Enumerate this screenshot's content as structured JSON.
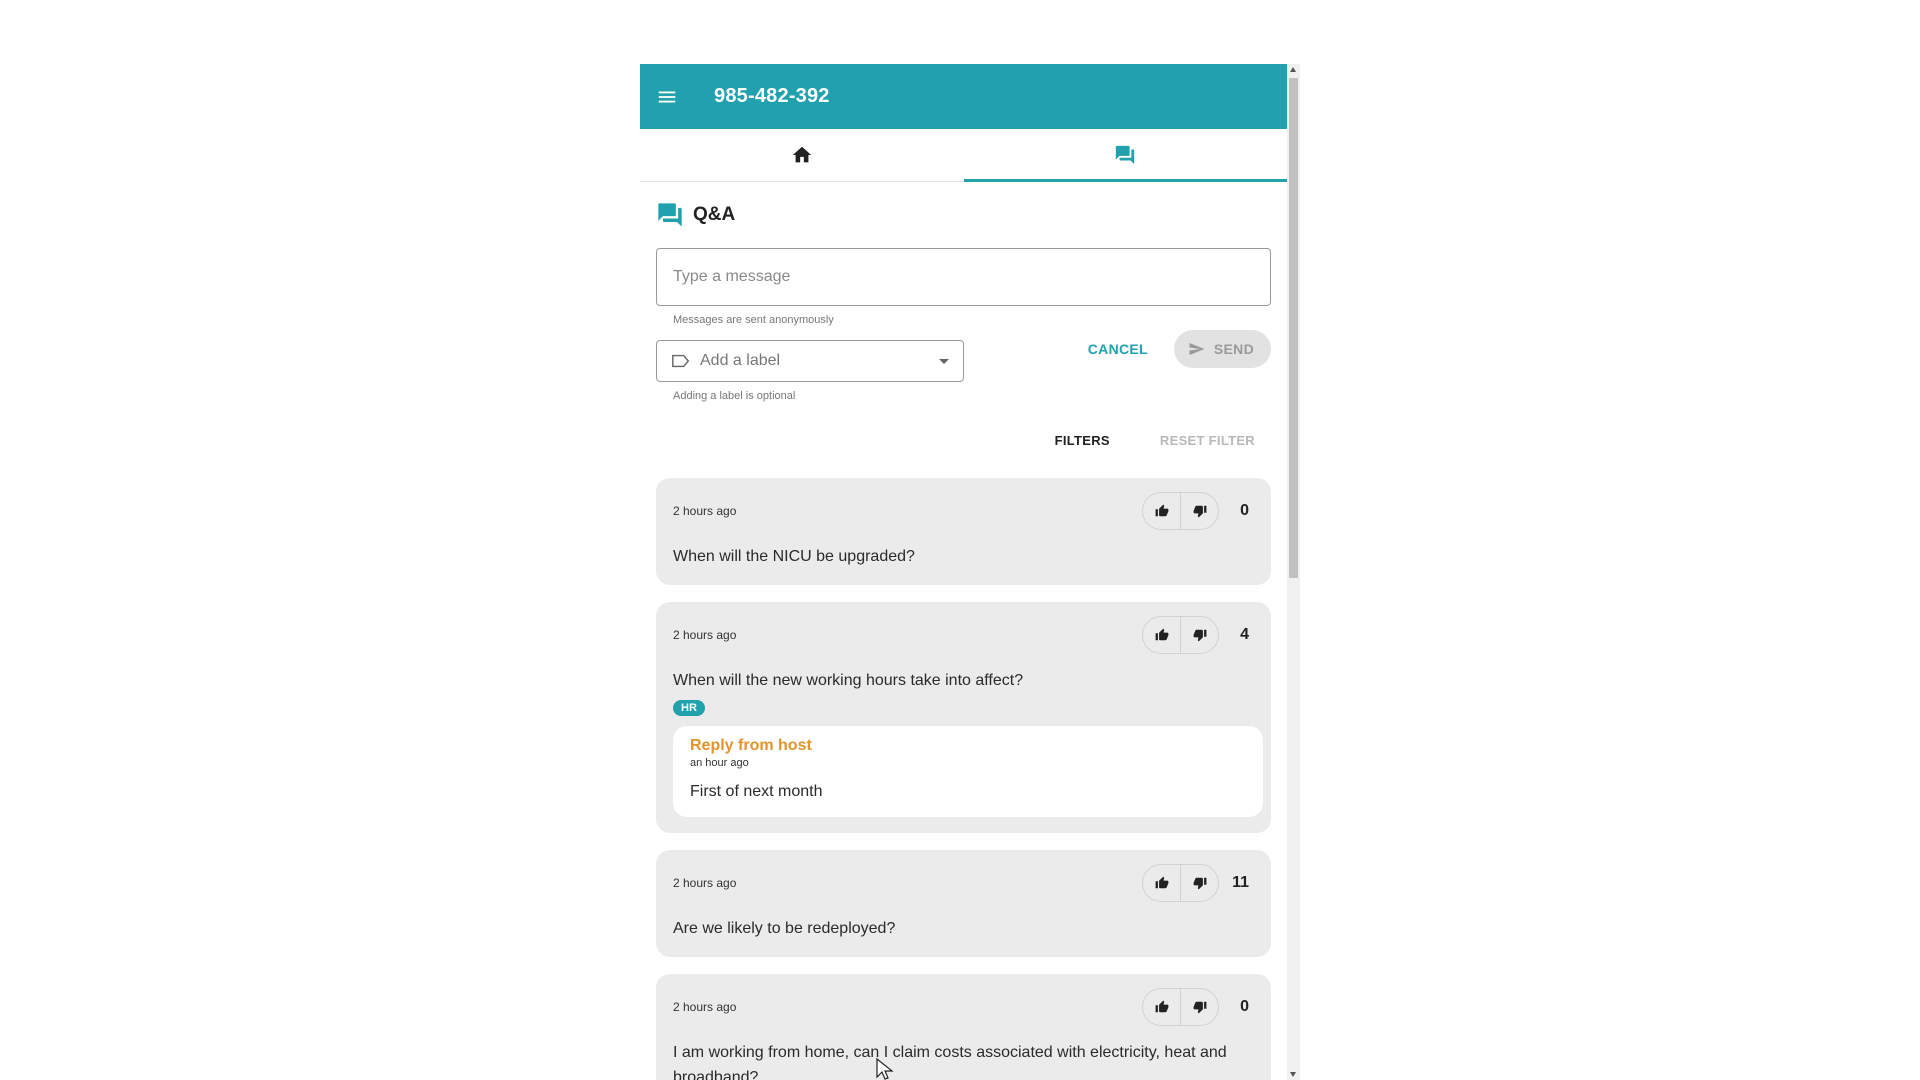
{
  "header": {
    "title": "985-482-392",
    "menu_icon": "menu-icon"
  },
  "tabs": [
    {
      "icon": "home-icon",
      "active": false
    },
    {
      "icon": "chat-icon",
      "active": true
    }
  ],
  "section": {
    "title": "Q&A",
    "icon": "chat-icon"
  },
  "composer": {
    "placeholder": "Type a message",
    "value": "",
    "hint": "Messages are sent anonymously",
    "label_placeholder": "Add a label",
    "label_hint": "Adding a label is optional",
    "cancel_label": "CANCEL",
    "send_label": "SEND"
  },
  "filters": {
    "filters_label": "FILTERS",
    "reset_label": "RESET FILTER"
  },
  "questions": [
    {
      "time": "2 hours ago",
      "text": "When will the NICU be upgraded?",
      "count": "0"
    },
    {
      "time": "2 hours ago",
      "text": "When will the new working hours take into affect?",
      "count": "4",
      "badge": "HR",
      "reply": {
        "title": "Reply from host",
        "time": "an hour ago",
        "text": "First of next month"
      }
    },
    {
      "time": "2 hours ago",
      "text": "Are we likely to be redeployed?",
      "count": "11"
    },
    {
      "time": "2 hours ago",
      "text": "I am working from home, can I claim costs associated with electricity, heat and broadband?",
      "count": "0"
    }
  ],
  "colors": {
    "accent": "#20a1ad",
    "reply_title": "#e3932b",
    "card_bg": "#ebebeb"
  }
}
